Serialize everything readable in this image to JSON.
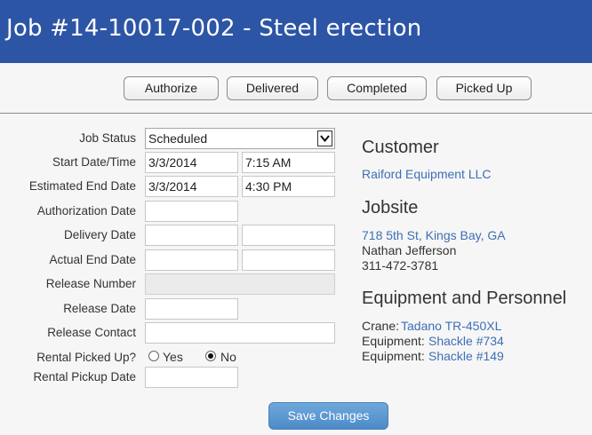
{
  "header": {
    "title": "Job #14-10017-002 - Steel erection"
  },
  "toolbar": {
    "buttons": [
      "Authorize",
      "Delivered",
      "Completed",
      "Picked Up"
    ]
  },
  "form": {
    "job_status": {
      "label": "Job Status",
      "value": "Scheduled"
    },
    "start": {
      "label": "Start Date/Time",
      "date": "3/3/2014",
      "time": "7:15 AM"
    },
    "est_end": {
      "label": "Estimated End Date",
      "date": "3/3/2014",
      "time": "4:30 PM"
    },
    "auth_date": {
      "label": "Authorization Date",
      "value": ""
    },
    "delivery_date": {
      "label": "Delivery Date",
      "date": "",
      "time": ""
    },
    "actual_end": {
      "label": "Actual End Date",
      "date": "",
      "time": ""
    },
    "release_number": {
      "label": "Release Number",
      "value": ""
    },
    "release_date": {
      "label": "Release Date",
      "value": ""
    },
    "release_contact": {
      "label": "Release Contact",
      "value": ""
    },
    "rental_picked_up": {
      "label": "Rental Picked Up?",
      "yes": "Yes",
      "no": "No",
      "selected": "No"
    },
    "rental_pickup_date": {
      "label": "Rental Pickup Date",
      "value": ""
    }
  },
  "customer": {
    "title": "Customer",
    "name": "Raiford Equipment LLC"
  },
  "jobsite": {
    "title": "Jobsite",
    "address": "718 5th St, Kings Bay, GA",
    "contact": "Nathan Jefferson",
    "phone": "311-472-3781"
  },
  "equipment": {
    "title": "Equipment and Personnel",
    "items": [
      {
        "type": "Crane:",
        "name": "Tadano TR-450XL"
      },
      {
        "type": "Equipment:",
        "name": "Shackle #734"
      },
      {
        "type": "Equipment:",
        "name": "Shackle #149"
      }
    ]
  },
  "actions": {
    "save_label": "Save Changes"
  }
}
